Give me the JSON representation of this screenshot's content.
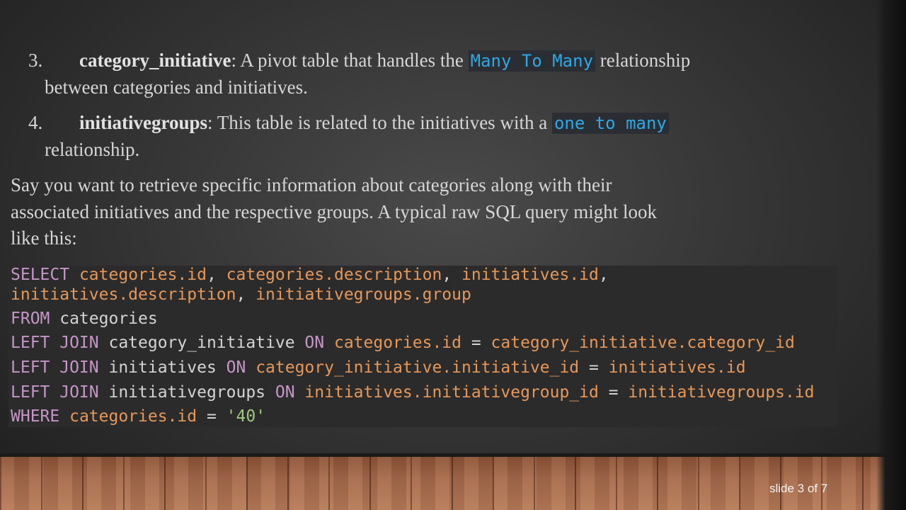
{
  "list": [
    {
      "number": "3.",
      "term": "category_initiative",
      "pre": ": A pivot table that handles the ",
      "code": "Many To Many",
      "post": " relationship",
      "cont": "between categories and initiatives."
    },
    {
      "number": "4.",
      "term": "initiativegroups",
      "pre": ": This table is related to the initiatives with a ",
      "code": "one to many",
      "post": "",
      "cont": "relationship."
    }
  ],
  "paragraph": {
    "line1": "Say you want to retrieve specific information about categories along with their",
    "line2": "associated initiatives and the respective groups. A typical raw SQL query might look",
    "line3": "like this:"
  },
  "code": {
    "line1": {
      "kw": "SELECT",
      "a": "categories.id",
      "s1": ", ",
      "b": "categories.description",
      "s2": ", ",
      "c": "initiatives.id",
      "s3": ","
    },
    "line2": {
      "a": "initiatives.description",
      "s1": ", ",
      "b": "initiativegroups.group"
    },
    "line3": {
      "kw": "FROM",
      "t": " categories"
    },
    "line4": {
      "kw": "LEFT JOIN",
      "t": " category_initiative ",
      "on": "ON",
      "a": " categories.id",
      "eq": " = ",
      "b": "category_initiative.category_id"
    },
    "line5": {
      "kw": "LEFT JOIN",
      "t": " initiatives ",
      "on": "ON",
      "a": " category_initiative.initiative_id",
      "eq": " = ",
      "b": "initiatives.id"
    },
    "line6": {
      "kw": "LEFT JOIN",
      "t": " initiativegroups ",
      "on": "ON",
      "a": " initiatives.initiativegroup_id",
      "eq": " = ",
      "b": "initiativegroups.id"
    },
    "line7": {
      "kw": "WHERE",
      "a": " categories.id",
      "eq": " = ",
      "str": "'40'"
    }
  },
  "footer": {
    "slide_number": "slide 3 of 7"
  },
  "colors": {
    "keyword": "#c596c7",
    "reference": "#e6985a",
    "string": "#9ec97e",
    "inline_code": "#2fa8e6"
  }
}
